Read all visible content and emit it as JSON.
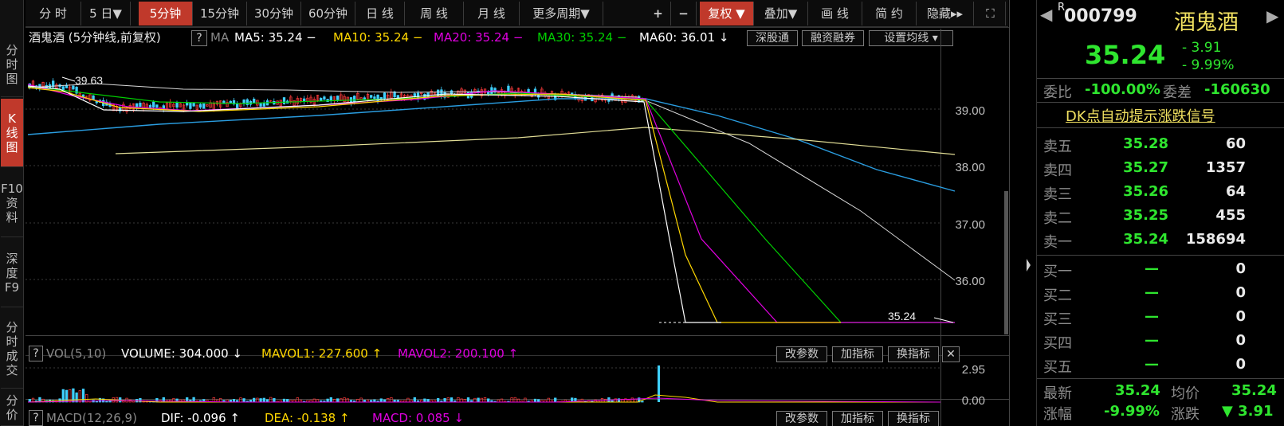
{
  "toolbar": {
    "periods": [
      "分 时",
      "5 日▼",
      "5分钟",
      "15分钟",
      "30分钟",
      "60分钟",
      "日 线",
      "周 线",
      "月 线",
      "更多周期▼"
    ],
    "active_period": "5分钟",
    "zoom_in": "+",
    "zoom_out": "−",
    "fuquan": "复权 ▼",
    "overlay": "叠加▼",
    "draw": "画 线",
    "simple": "简 约",
    "hide": "隐藏▸▸",
    "fullscreen": "⛶"
  },
  "sidebar": {
    "tabs": [
      {
        "label": "分时图",
        "active": false
      },
      {
        "label": "K线图",
        "active": true
      },
      {
        "label": "F10资料",
        "active": false
      },
      {
        "label": "深度F9",
        "active": false
      },
      {
        "label": "分时成交",
        "active": false
      },
      {
        "label": "分价",
        "active": false
      }
    ]
  },
  "main_chart": {
    "title": "酒鬼酒 (5分钟线,前复权)",
    "ma_label": "MA",
    "ma": [
      {
        "label": "MA5: 35.24 −",
        "color": "#ffffff"
      },
      {
        "label": "MA10: 35.24 −",
        "color": "#ffd700"
      },
      {
        "label": "MA20: 35.24 −",
        "color": "#e000e0"
      },
      {
        "label": "MA30: 35.24 −",
        "color": "#00d000"
      },
      {
        "label": "MA60: 36.01 ↓",
        "color": "#ffffff"
      }
    ],
    "buttons": [
      "深股通",
      "融资融券",
      "设置均线 ▾"
    ],
    "high_label": "39.63",
    "last_label": "35.24",
    "y_ticks": [
      "39.00",
      "38.00",
      "37.00",
      "36.00"
    ]
  },
  "volume_panel": {
    "title": "VOL(5,10)",
    "items": [
      {
        "label": "VOLUME: 304.000 ↓",
        "color": "#ffffff"
      },
      {
        "label": "MAVOL1: 227.600 ↑",
        "color": "#ffd700"
      },
      {
        "label": "MAVOL2: 200.100 ↑",
        "color": "#e000e0"
      }
    ],
    "buttons": [
      "改参数",
      "加指标",
      "换指标",
      "✕"
    ],
    "y_ticks": [
      "2.95",
      "0.00"
    ]
  },
  "macd_panel": {
    "title": "MACD(12,26,9)",
    "items": [
      {
        "label": "DIF: -0.096 ↑",
        "color": "#ffffff"
      },
      {
        "label": "DEA: -0.138 ↑",
        "color": "#ffd700"
      },
      {
        "label": "MACD: 0.085 ↓",
        "color": "#e000e0"
      }
    ],
    "buttons": [
      "改参数",
      "加指标",
      "换指标",
      "✕"
    ]
  },
  "quote": {
    "code_prefix": "R",
    "code": "000799",
    "name": "酒鬼酒",
    "price": "35.24",
    "change": "- 3.91",
    "change_pct": "- 9.99%",
    "weibi_label": "委比",
    "weibi": "-100.00%",
    "weicha_label": "委差",
    "weicha": "-160630",
    "signal_link": "DK点自动提示涨跌信号",
    "asks": [
      {
        "label": "卖五",
        "price": "35.28",
        "vol": "60"
      },
      {
        "label": "卖四",
        "price": "35.27",
        "vol": "1357"
      },
      {
        "label": "卖三",
        "price": "35.26",
        "vol": "64"
      },
      {
        "label": "卖二",
        "price": "35.25",
        "vol": "455"
      },
      {
        "label": "卖一",
        "price": "35.24",
        "vol": "158694"
      }
    ],
    "bids": [
      {
        "label": "买一",
        "price": "—",
        "vol": "0"
      },
      {
        "label": "买二",
        "price": "—",
        "vol": "0"
      },
      {
        "label": "买三",
        "price": "—",
        "vol": "0"
      },
      {
        "label": "买四",
        "price": "—",
        "vol": "0"
      },
      {
        "label": "买五",
        "price": "—",
        "vol": "0"
      }
    ],
    "latest_label": "最新",
    "latest": "35.24",
    "avg_label": "均价",
    "avg": "35.24",
    "pct_label": "涨幅",
    "pct": "-9.99%",
    "chg_label": "涨跌",
    "chg": "▼ 3.91"
  },
  "colors": {
    "up": "#ff3b3b",
    "down": "#2fe62f",
    "accent": "#c0392b",
    "bg": "#000000"
  }
}
